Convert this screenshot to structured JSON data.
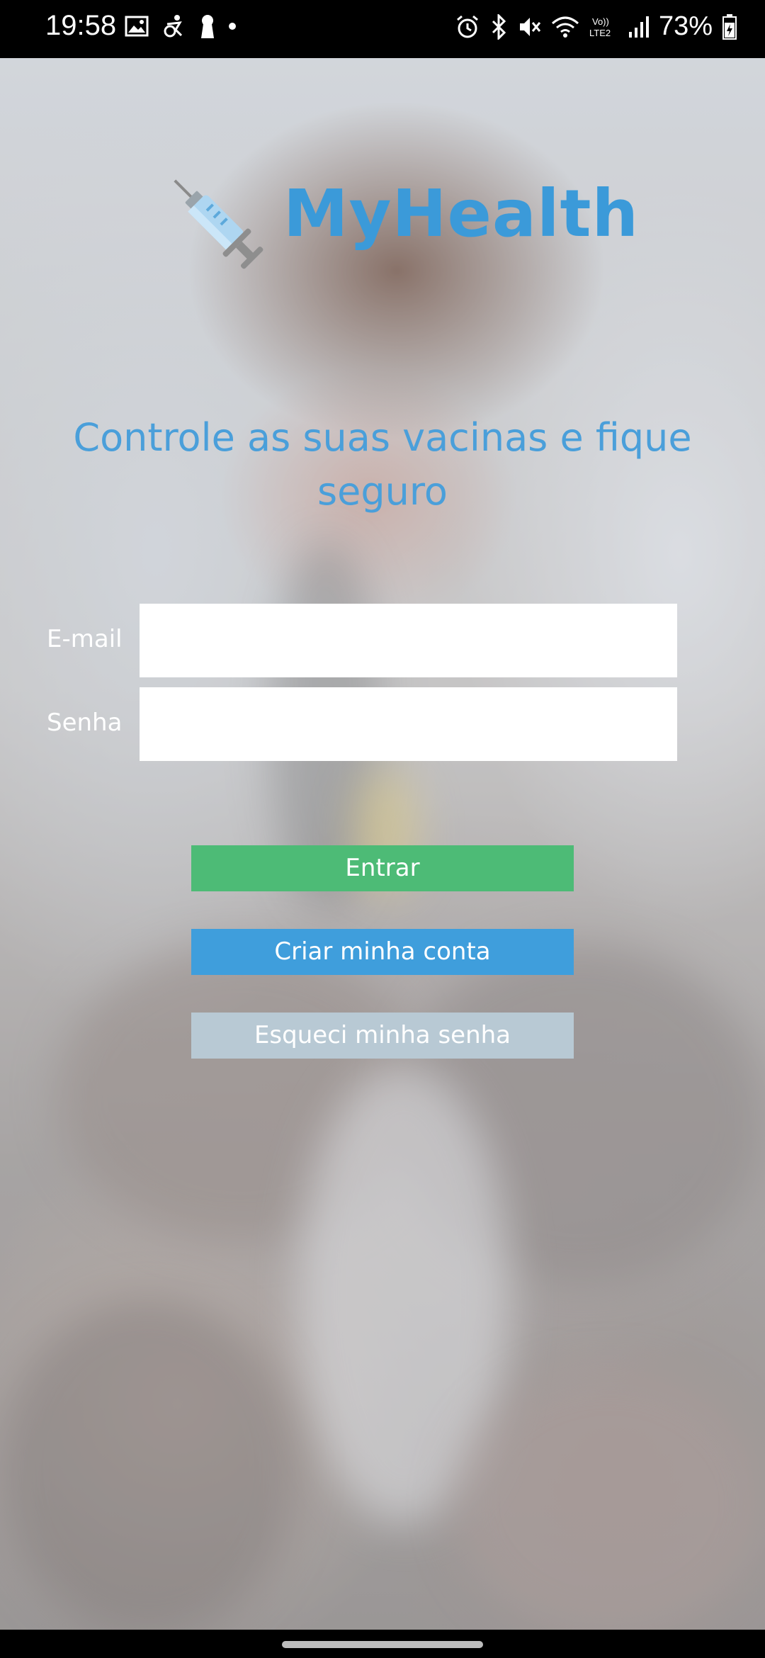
{
  "status_bar": {
    "time": "19:58",
    "battery": "73%",
    "left_icons": [
      "image-icon",
      "accessibility-icon",
      "keyhole-icon",
      "dot-icon"
    ],
    "right_icons": [
      "alarm-icon",
      "bluetooth-icon",
      "mute-icon",
      "wifi-icon",
      "volte-icon",
      "signal-icon",
      "battery-icon"
    ]
  },
  "app": {
    "title": "MyHealth",
    "tagline": "Controle as suas vacinas e fique seguro",
    "brand_color": "#3b9ad9"
  },
  "form": {
    "email_label": "E-mail",
    "email_value": "",
    "password_label": "Senha",
    "password_value": ""
  },
  "buttons": {
    "login": "Entrar",
    "create_account": "Criar minha conta",
    "forgot_password": "Esqueci minha senha"
  },
  "colors": {
    "login_button": "#4dbb76",
    "create_button": "#3f9edc",
    "forgot_button": "#b8c9d4"
  }
}
